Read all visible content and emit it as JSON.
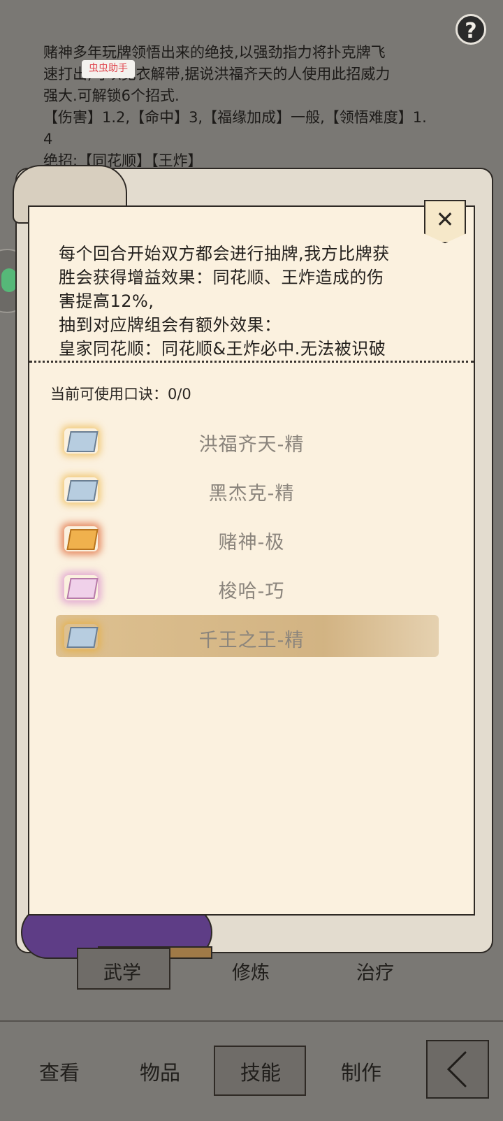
{
  "background": {
    "desc_lines": [
      "赌神多年玩牌领悟出来的绝技,以强劲指力将扑克牌飞",
      "速打出,可以宽衣解带,据说洪福齐天的人使用此招威力",
      "强大.可解锁6个招式.",
      "【伤害】1.2,【命中】3,【福缘加成】一般,【领悟难度】1.",
      "4",
      "绝招:【同花顺】【王炸】"
    ],
    "tag": "虫虫助手",
    "help": "?"
  },
  "panel": {
    "close": "✕",
    "effect_lines": [
      "每个回合开始双方都会进行抽牌,我方比牌获",
      "胜会获得增益效果：同花顺、王炸造成的伤",
      "害提高12%,",
      "抽到对应牌组会有额外效果：",
      "皇家同花顺：同花顺&王炸必中.无法被识破"
    ],
    "usable_label": "当前可使用口诀：",
    "usable_value": "0/0",
    "items": [
      {
        "label": "洪福齐天-精",
        "icon": "scroll-icon-blue"
      },
      {
        "label": "黑杰克-精",
        "icon": "scroll-icon-blue"
      },
      {
        "label": "赌神-极",
        "icon": "scroll-icon-gold"
      },
      {
        "label": "梭哈-巧",
        "icon": "scroll-icon-pink"
      },
      {
        "label": "千王之王-精",
        "icon": "scroll-icon-blue",
        "selected": true
      }
    ]
  },
  "tabs": [
    "武学",
    "修炼",
    "治疗"
  ],
  "bottom_nav": [
    "查看",
    "物品",
    "技能",
    "制作"
  ],
  "active_tab": "武学",
  "active_nav": "技能"
}
